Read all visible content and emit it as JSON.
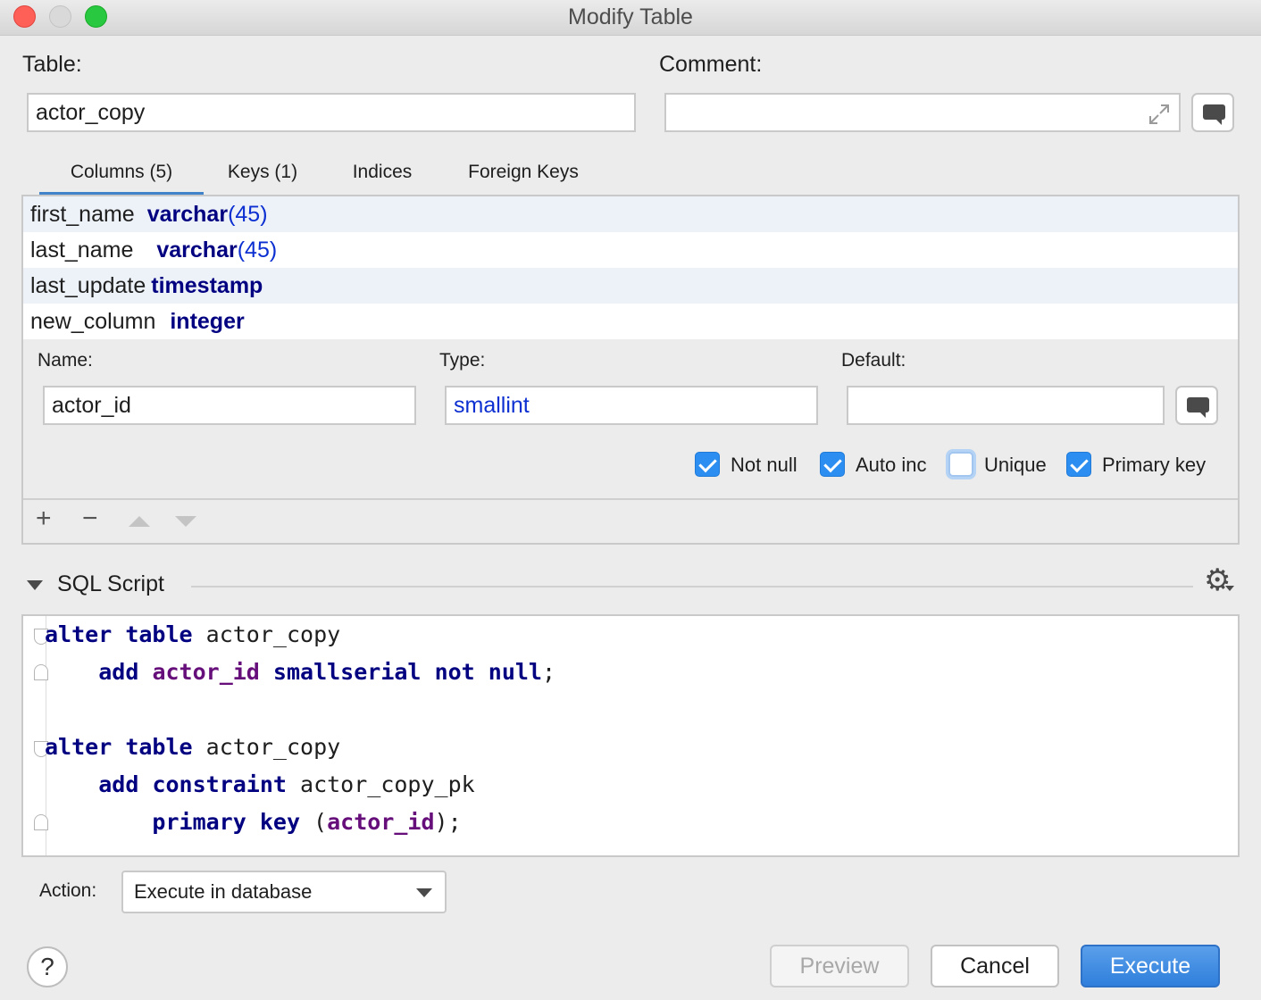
{
  "window": {
    "title": "Modify Table"
  },
  "table": {
    "label": "Table:",
    "value": "actor_copy"
  },
  "comment": {
    "label": "Comment:",
    "value": ""
  },
  "tabs": [
    {
      "label": "Columns (5)",
      "active": true
    },
    {
      "label": "Keys (1)",
      "active": false
    },
    {
      "label": "Indices",
      "active": false
    },
    {
      "label": "Foreign Keys",
      "active": false
    }
  ],
  "columns": [
    {
      "name": "first_name",
      "type": "varchar",
      "size": "(45)"
    },
    {
      "name": "last_name",
      "type": "varchar",
      "size": "(45)"
    },
    {
      "name": "last_update",
      "type": "timestamp",
      "size": ""
    },
    {
      "name": "new_column",
      "type": "integer",
      "size": ""
    }
  ],
  "editor": {
    "name_label": "Name:",
    "name_value": "actor_id",
    "type_label": "Type:",
    "type_value": "smallint",
    "default_label": "Default:",
    "default_value": "",
    "checks": [
      {
        "label": "Not null",
        "checked": true
      },
      {
        "label": "Auto inc",
        "checked": true
      },
      {
        "label": "Unique",
        "checked": false
      },
      {
        "label": "Primary key",
        "checked": true
      }
    ]
  },
  "toolbar": {
    "add": "+",
    "remove": "−"
  },
  "sql": {
    "header": "SQL Script",
    "lines": [
      "alter table actor_copy",
      "    add actor_id smallserial not null;",
      "",
      "alter table actor_copy",
      "    add constraint actor_copy_pk",
      "        primary key (actor_id);"
    ]
  },
  "action": {
    "label": "Action:",
    "value": "Execute in database"
  },
  "buttons": {
    "help": "?",
    "preview": "Preview",
    "cancel": "Cancel",
    "execute": "Execute"
  },
  "colors": {
    "accent": "#2f7fdc",
    "keyword": "#000080",
    "identifier": "#660e7a",
    "number": "#0b2fd1"
  }
}
